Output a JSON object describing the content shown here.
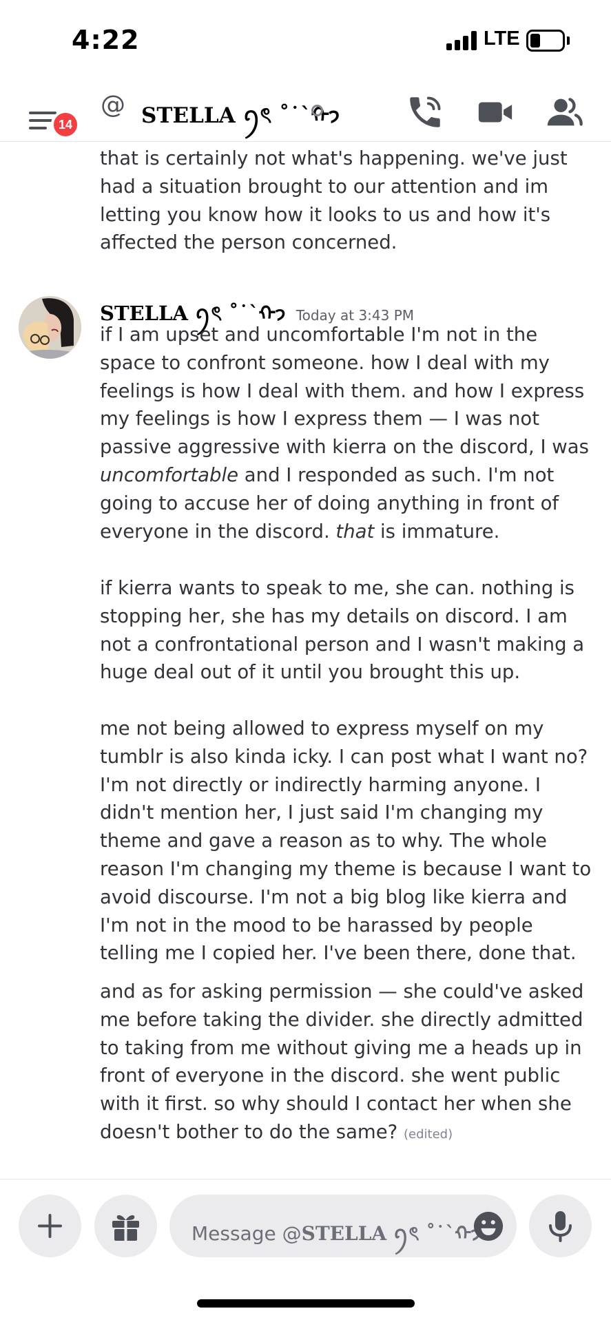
{
  "status_bar": {
    "time": "4:22",
    "network": "LTE"
  },
  "header": {
    "badge_count": "14",
    "at_symbol": "@",
    "title": "STELLA ꪆৎ ˚˙`ᡣ𐭩"
  },
  "messages": {
    "continued_text": "that is certainly not what's happening. we've just had a situation brought to our attention and im letting you know how it looks to us and how it's affected the person concerned.",
    "author": "STELLA ꪆৎ ˚˙`ᡣ𐭩",
    "timestamp": "Today at 3:43 PM",
    "para1_a": "if I am upset and uncomfortable I'm not in the space to confront someone. how I deal with my feelings is how I deal with them. and how I express my feelings is how I express them — I was not passive aggressive with kierra on the discord, I was ",
    "para1_em1": "uncomfortable",
    "para1_b": " and I responded as such. I'm not going to accuse her of doing anything in front of everyone in the discord. ",
    "para1_em2": "that",
    "para1_c": " is immature.",
    "para2": "if kierra wants to speak to me, she can. nothing is stopping her, she has my details on discord. I am not a confrontational person and I wasn't making a huge deal out of it until you brought this up.",
    "para3": "me not being allowed to express myself on my tumblr is also kinda icky. I can post what I want no? I'm not directly or indirectly harming anyone. I didn't mention her, I just said I'm changing my theme and gave a reason as to why. The whole reason I'm changing my theme is because I want to avoid discourse. I'm not a big blog like kierra and I'm not in the mood to be harassed by people telling me I copied her. I've been there, done that.",
    "para4": "and as for asking permission — she could've asked me before taking the divider. she directly admitted to taking from me without giving me a heads up in front of everyone in the discord. she went public with it first. so why should I contact her when she doesn't bother to do the same?",
    "edited_label": "(edited)"
  },
  "composer": {
    "placeholder_prefix": "Message @",
    "placeholder_name": "STELLA ꪆৎ ˚˙`ᡣ𐭩"
  },
  "icons": {
    "menu": "hamburger-menu-icon",
    "call": "phone-call-icon",
    "video": "video-camera-icon",
    "members": "members-icon",
    "add": "plus-icon",
    "gift": "gift-icon",
    "emoji": "emoji-icon",
    "mic": "microphone-icon"
  },
  "colors": {
    "badge": "#f23f42",
    "text": "#313338",
    "muted": "#5c5e66",
    "button_bg": "#ebebed",
    "icon": "#4e5058"
  }
}
